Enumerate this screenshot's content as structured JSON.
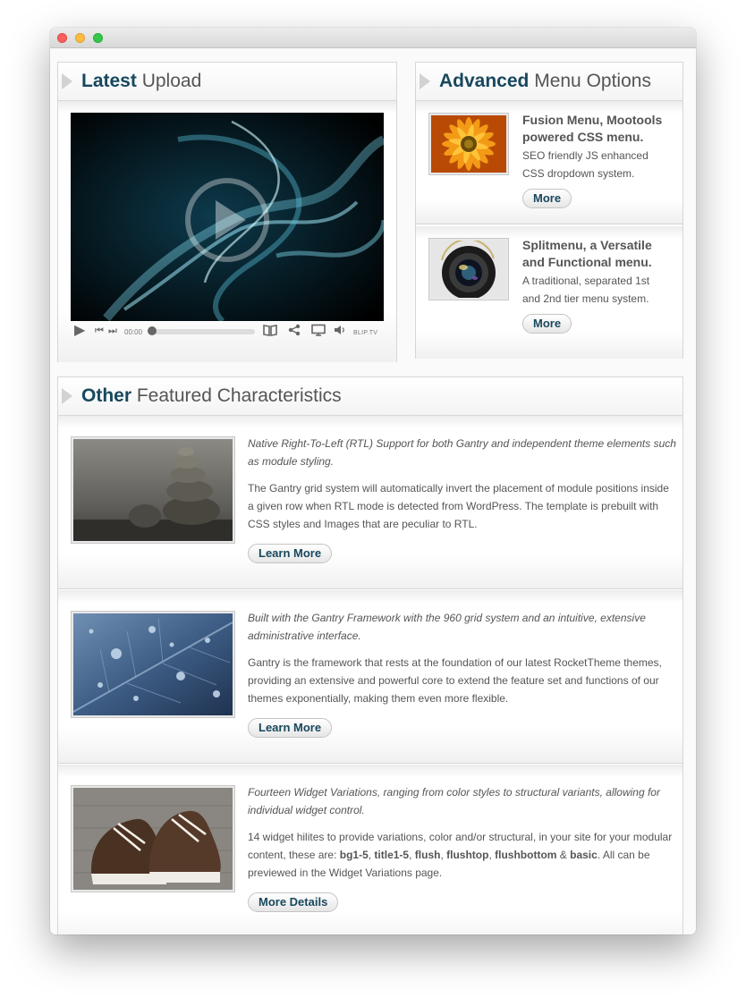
{
  "window": {
    "controls": [
      "close",
      "minimize",
      "zoom"
    ]
  },
  "latest": {
    "title_bold": "Latest",
    "title_rest": " Upload",
    "player": {
      "time": "00:00",
      "brand": "BLIP.TV",
      "icons": [
        "play-icon",
        "previous-icon",
        "next-icon",
        "book-icon",
        "share-icon",
        "screen-icon",
        "volume-icon"
      ]
    }
  },
  "advanced": {
    "title_bold": "Advanced",
    "title_rest": " Menu Options",
    "items": [
      {
        "heading": "Fusion Menu, Mootools powered CSS menu.",
        "text": "SEO friendly JS enhanced CSS dropdown system.",
        "button": "More"
      },
      {
        "heading": "Splitmenu, a Versatile and Functional menu.",
        "text": "A traditional, separated 1st and 2nd tier menu system.",
        "button": "More"
      }
    ]
  },
  "other": {
    "title_bold": "Other",
    "title_rest": " Featured Characteristics",
    "items": [
      {
        "lead": "Native Right-To-Left (RTL) Support for both Gantry and independent theme elements such as module styling.",
        "body": "The Gantry grid system will automatically invert the placement of module positions inside a given row when RTL mode is detected from WordPress. The template is prebuilt with CSS styles and Images that are peculiar to RTL.",
        "button": "Learn More"
      },
      {
        "lead": "Built with the Gantry Framework with the 960 grid system and an intuitive, extensive administrative interface.",
        "body": "Gantry is the framework that rests at the foundation of our latest RocketTheme themes, providing an extensive and powerful core to extend the feature set and functions of our themes exponentially, making them even more flexible.",
        "button": "Learn More"
      },
      {
        "lead": "Fourteen Widget Variations, ranging from color styles to structural variants, allowing for individual widget control.",
        "body_pre": "14 widget hilites to provide variations, color and/or structural, in your site for your modular content, these are: ",
        "v1": "bg1-5",
        "sep1": ", ",
        "v2": "title1-5",
        "sep2": ", ",
        "v3": "flush",
        "sep3": ", ",
        "v4": "flushtop",
        "sep4": ", ",
        "v5": "flushbottom",
        "sep5": " & ",
        "v6": "basic",
        "body_post": ". All can be previewed in the Widget Variations page.",
        "button": "More Details"
      }
    ]
  }
}
